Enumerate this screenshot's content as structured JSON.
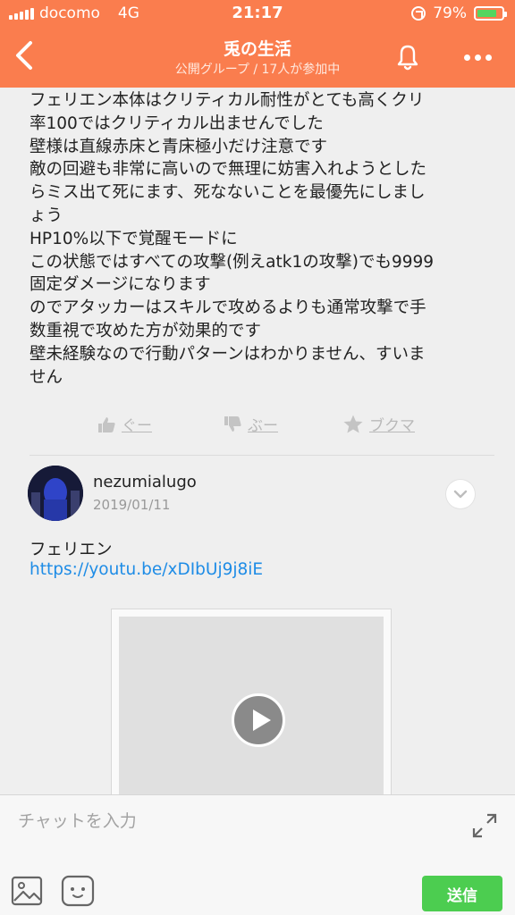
{
  "status_bar": {
    "carrier": "docomo",
    "network": "4G",
    "time": "21:17",
    "battery": "79%",
    "battery_level": 0.79
  },
  "nav": {
    "title": "兎の生活",
    "subtitle": "公開グループ / 17人が参加中"
  },
  "message": {
    "lines": [
      "フェリエン本体はクリティカル耐性がとても高くクリ",
      "率100ではクリティカル出ませんでした",
      "壁様は直線赤床と青床極小だけ注意です",
      "敵の回避も非常に高いので無理に妨害入れようとした",
      "らミス出て死にます、死なないことを最優先にしまし",
      "ょう",
      "HP10%以下で覚醒モードに",
      "この状態ではすべての攻撃(例えatk1の攻撃)でも9999",
      "固定ダメージになります",
      "のでアタッカーはスキルで攻めるよりも通常攻撃で手",
      "数重視で攻めた方が効果的です",
      "壁未経験なので行動パターンはわかりません、すいま",
      "せん"
    ],
    "reactions": {
      "like": "ぐー",
      "dislike": "ぶー",
      "bookmark": "ブクマ"
    }
  },
  "post": {
    "username": "nezumialugo",
    "date": "2019/01/11",
    "text": "フェリエン",
    "link": "https://youtu.be/xDIbUj9j8iE"
  },
  "chat": {
    "placeholder": "チャットを入力",
    "send_label": "送信"
  },
  "colors": {
    "header": "#fa7d4e",
    "link": "#1e8ce6",
    "send": "#4ccd50"
  }
}
